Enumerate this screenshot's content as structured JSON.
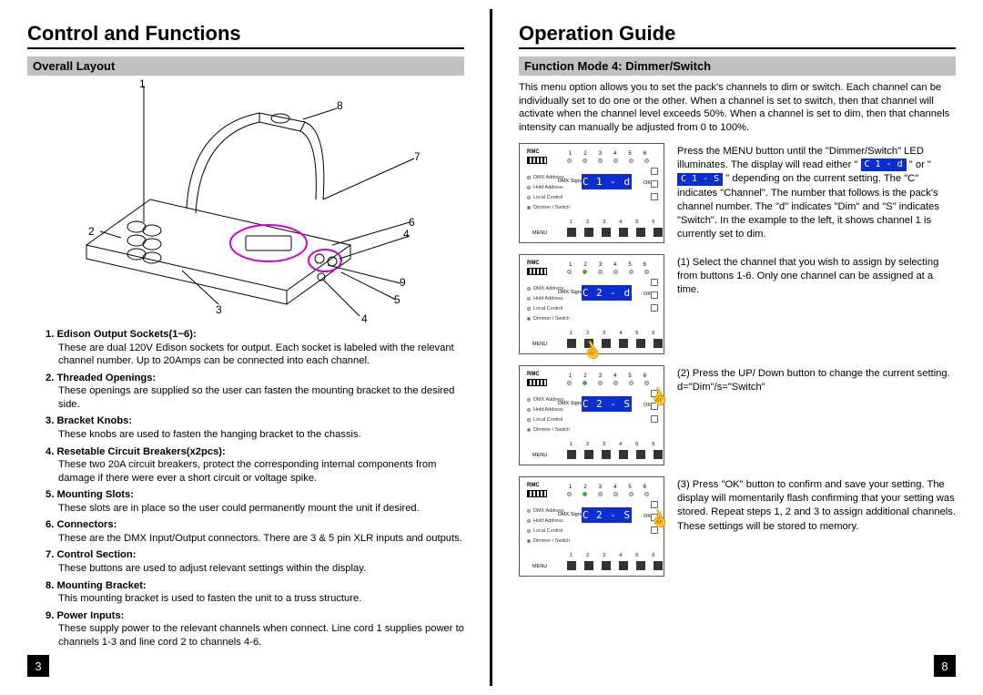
{
  "left": {
    "title": "Control and Functions",
    "section": "Overall Layout",
    "callouts": [
      "1",
      "2",
      "3",
      "4",
      "4",
      "5",
      "6",
      "7",
      "8",
      "9"
    ],
    "items": [
      {
        "num": "1.",
        "label": "Edison Output Sockets(1~6):",
        "desc": "These are dual 120V Edison sockets for output. Each socket is labeled with the relevant channel number. Up to 20Amps can be connected into each channel."
      },
      {
        "num": "2.",
        "label": "Threaded Openings:",
        "desc": "These openings are supplied so the user can fasten the mounting bracket to the desired side."
      },
      {
        "num": "3.",
        "label": "Bracket Knobs:",
        "desc": "These knobs are used to fasten the hanging bracket to the chassis."
      },
      {
        "num": "4.",
        "label": "Resetable Circuit Breakers(x2pcs):",
        "desc": "These two 20A circuit breakers, protect the corresponding internal components from damage if there were ever a short circuit or voltage spike."
      },
      {
        "num": "5.",
        "label": "Mounting Slots:",
        "desc": "These slots are in place so the user could permanently mount the unit if desired."
      },
      {
        "num": "6.",
        "label": "Connectors:",
        "desc": "These are the DMX Input/Output connectors. There are 3 & 5 pin XLR inputs and outputs."
      },
      {
        "num": "7.",
        "label": "Control Section:",
        "desc": "These buttons are used to adjust relevant settings within the display."
      },
      {
        "num": "8.",
        "label": "Mounting Bracket:",
        "desc": "This mounting bracket is used to fasten the unit to a truss structure."
      },
      {
        "num": "9.",
        "label": "Power Inputs:",
        "desc": "These supply power to the relevant channels when connect. Line cord 1 supplies power to channels 1-3 and line cord 2 to channels 4-6."
      }
    ],
    "pagenum": "3"
  },
  "right": {
    "title": "Operation Guide",
    "section": "Function Mode 4:  Dimmer/Switch",
    "intro": "This menu option allows you to set the pack's channels to dim or switch. Each channel can be individually set to do one or the other. When a channel is set to switch, then that channel will activate when the channel level exceeds 50%. When a channel is set to dim, then that channels intensity can manually be adjusted from 0 to 100%.",
    "panel_labels": {
      "brand": "RMC",
      "side": [
        "DMX Address",
        "Hold Address",
        "Local Control",
        "Dimmer / Switch"
      ],
      "signal": "DMX Signal",
      "ok": "OK",
      "menu": "MENU",
      "nums": [
        "1",
        "2",
        "3",
        "4",
        "5",
        "6"
      ]
    },
    "steps": [
      {
        "disp": "C 1 - d",
        "text_pre": "Press the MENU button until the \"Dimmer/Switch\" LED illuminates. The display will read either \" ",
        "chip1": "C 1 - d",
        "mid": " \" or \" ",
        "chip2": "C 1 - S",
        "text_post": " \" depending on the current setting. The \"C\" indicates \"Channel\". The number that follows is the pack's channel number. The \"d\" indicates \"Dim\" and \"S\" indicates \"Switch\". In the example to the left, it shows channel 1 is currently set to dim."
      },
      {
        "disp": "C 2 - d",
        "text": "(1) Select the channel that you wish to assign by selecting from buttons 1-6. Only one channel can be assigned at a time."
      },
      {
        "disp": "C 2 - S",
        "text": "(2) Press the UP/ Down button to change the current setting. d=\"Dim\"/s=\"Switch\""
      },
      {
        "disp": "C 2 - S",
        "text": "(3) Press \"OK\" button to confirm and save your setting. The display will momentarily flash confirming that your setting was stored. Repeat steps 1, 2 and 3 to assign additional channels. These settings will be stored to memory."
      }
    ],
    "pagenum": "8"
  }
}
